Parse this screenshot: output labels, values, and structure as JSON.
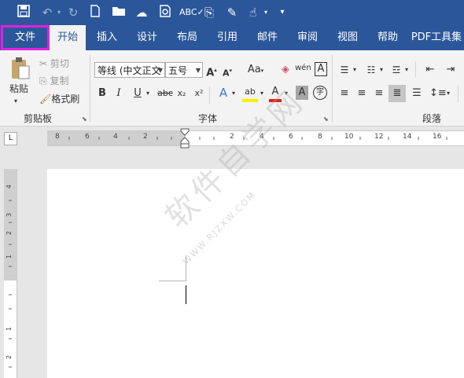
{
  "quick_access": {
    "icons": [
      "save-icon",
      "undo-icon",
      "redo-icon",
      "new-document-icon",
      "open-folder-icon",
      "save-cloud-icon",
      "print-preview-icon",
      "spelling-icon",
      "attach-icon",
      "edit-icon",
      "touch-mode-icon",
      "customize-icon"
    ]
  },
  "tabs": [
    "文件",
    "开始",
    "插入",
    "设计",
    "布局",
    "引用",
    "邮件",
    "审阅",
    "视图",
    "帮助",
    "PDF工具集"
  ],
  "clipboard": {
    "paste": "粘贴",
    "cut": "剪切",
    "copy": "复制",
    "format_painter": "格式刷",
    "group_label": "剪贴板"
  },
  "font": {
    "font_name": "等线 (中文正文",
    "font_size": "五号",
    "bold": "B",
    "italic": "I",
    "underline": "U",
    "strikethrough": "abc",
    "subscript": "x₂",
    "superscript": "x²",
    "grow": "A",
    "shrink": "A",
    "change_case": "Aa",
    "phonetic": "wén",
    "border_char": "A",
    "text_effect": "A",
    "highlight": "ab",
    "font_color": "A",
    "shade": "A",
    "enclose": "字",
    "group_label": "字体"
  },
  "paragraph": {
    "group_label": "段落"
  },
  "ruler": {
    "h_marks": [
      "8",
      "6",
      "4",
      "2",
      "2",
      "4",
      "6",
      "8",
      "10",
      "12",
      "14",
      "16"
    ],
    "v_marks": [
      "4",
      "3",
      "2",
      "1",
      "1",
      "2"
    ]
  },
  "corner": "L",
  "watermark": "软件自学网",
  "watermark_url": "WWW.RJZXW.COM",
  "colors": {
    "brand": "#2b579a",
    "file_highlight": "#e020e0"
  }
}
